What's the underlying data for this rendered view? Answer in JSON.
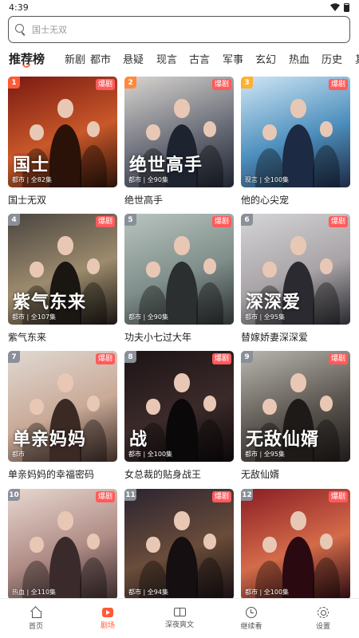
{
  "status_bar": {
    "time": "4:39"
  },
  "search": {
    "placeholder": "国士无双"
  },
  "tabs": [
    "推荐榜",
    "新剧",
    "都市",
    "悬疑",
    "现言",
    "古言",
    "军事",
    "玄幻",
    "热血",
    "历史",
    "其"
  ],
  "active_tab": 0,
  "badge_label": "爆剧",
  "dramas": [
    {
      "rank": "1",
      "title": "国士无双",
      "meta": "都市 | 全82集",
      "poster_text": "国士",
      "rank_color": "#ff5a36",
      "colors": [
        "#7a1a12",
        "#c9582a",
        "#2a1208"
      ]
    },
    {
      "rank": "2",
      "title": "绝世高手",
      "meta": "都市 | 全90集",
      "poster_text": "绝世高手",
      "rank_color": "#ff8a3d",
      "colors": [
        "#d8d4cf",
        "#6c6f7a",
        "#1e2330"
      ]
    },
    {
      "rank": "3",
      "title": "他的心尖宠",
      "meta": "现言 | 全100集",
      "poster_text": "",
      "rank_color": "#ffb02e",
      "colors": [
        "#cfe6f5",
        "#4d8fbd",
        "#1d2a44"
      ]
    },
    {
      "rank": "4",
      "title": "紫气东来",
      "meta": "都市 | 全107集",
      "poster_text": "紫气东来",
      "rank_color": "#8a8f99",
      "colors": [
        "#4a4540",
        "#9c8b6d",
        "#1a1612"
      ]
    },
    {
      "rank": "5",
      "title": "功夫小七过大年",
      "meta": "都市 | 全90集",
      "poster_text": "",
      "rank_color": "#8a8f99",
      "colors": [
        "#b8c4c0",
        "#7f8e8a",
        "#2b2f30"
      ]
    },
    {
      "rank": "6",
      "title": "替嫁娇妻深深爱",
      "meta": "都市 | 全95集",
      "poster_text": "深深爱",
      "rank_color": "#8a8f99",
      "colors": [
        "#d4d4d6",
        "#a8a3a6",
        "#2a2a30"
      ]
    },
    {
      "rank": "7",
      "title": "单亲妈妈的幸福密码",
      "meta": "都市",
      "poster_text": "单亲妈妈",
      "rank_color": "#8a8f99",
      "colors": [
        "#e0d9d2",
        "#c9a997",
        "#3b2a24"
      ]
    },
    {
      "rank": "8",
      "title": "女总裁的贴身战王",
      "meta": "都市 | 全100集",
      "poster_text": "战",
      "rank_color": "#8a8f99",
      "colors": [
        "#1c1416",
        "#3c2a2a",
        "#0b0809"
      ]
    },
    {
      "rank": "9",
      "title": "无敌仙婿",
      "meta": "都市 | 全95集",
      "poster_text": "无敌仙婿",
      "rank_color": "#8a8f99",
      "colors": [
        "#b9b6b0",
        "#5c5650",
        "#1e1a18"
      ]
    },
    {
      "rank": "10",
      "title": "",
      "meta": "热血 | 全110集",
      "poster_text": "",
      "rank_color": "#8a8f99",
      "colors": [
        "#e7d8d0",
        "#b08c86",
        "#3a2a2c"
      ]
    },
    {
      "rank": "11",
      "title": "",
      "meta": "都市 | 全94集",
      "poster_text": "",
      "rank_color": "#8a8f99",
      "colors": [
        "#2b2430",
        "#6a4c3a",
        "#150f12"
      ]
    },
    {
      "rank": "12",
      "title": "",
      "meta": "都市 | 全100集",
      "poster_text": "",
      "rank_color": "#8a8f99",
      "colors": [
        "#8a1d24",
        "#d46b4a",
        "#2a0a10"
      ]
    }
  ],
  "bottom_nav": [
    {
      "label": "首页",
      "icon": "home-icon"
    },
    {
      "label": "剧场",
      "icon": "theater-icon"
    },
    {
      "label": "深夜爽文",
      "icon": "book-icon"
    },
    {
      "label": "继续看",
      "icon": "clock-icon"
    },
    {
      "label": "设置",
      "icon": "gear-icon"
    }
  ],
  "active_nav": 1
}
